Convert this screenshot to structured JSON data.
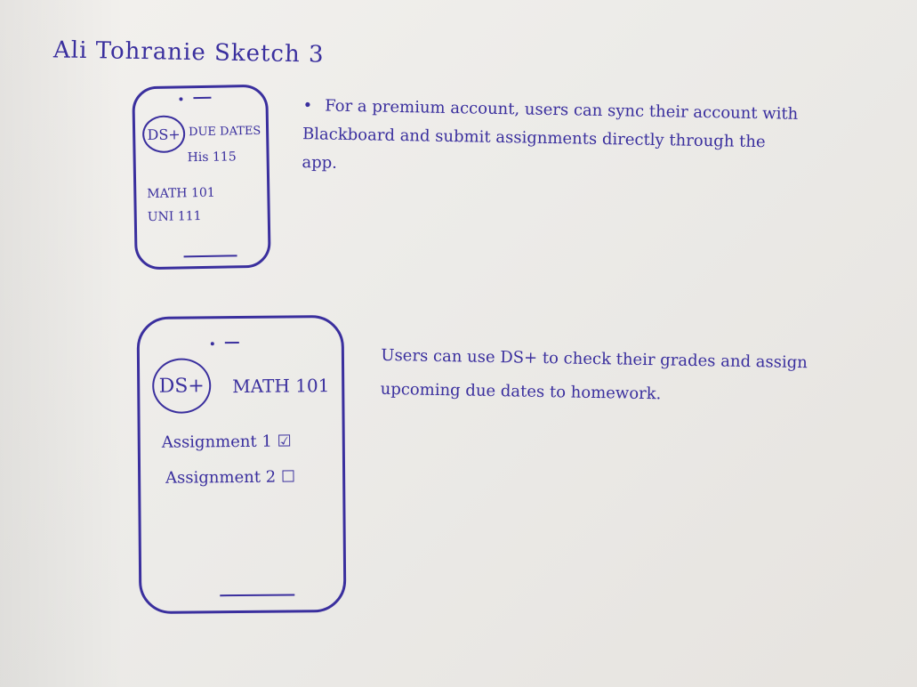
{
  "title": "Ali Tohranie Sketch 3",
  "phone1": {
    "logo": "DS+",
    "header": "DUE DATES",
    "items": [
      "His 115",
      "MATH 101",
      "UNI 111"
    ]
  },
  "phone2": {
    "logo": "DS+",
    "header": "MATH 101",
    "items": [
      "Assignment 1 ☑",
      "Assignment 2 ☐"
    ]
  },
  "note1": {
    "bullet": "•",
    "text": "For a premium account, users can sync their account with Blackboard and submit assignments directly through the app."
  },
  "note2": {
    "text": "Users can use DS+ to check their grades and assign upcoming due dates to homework."
  },
  "colors": {
    "ink": "#3a2f9e",
    "paper": "#efede9"
  }
}
